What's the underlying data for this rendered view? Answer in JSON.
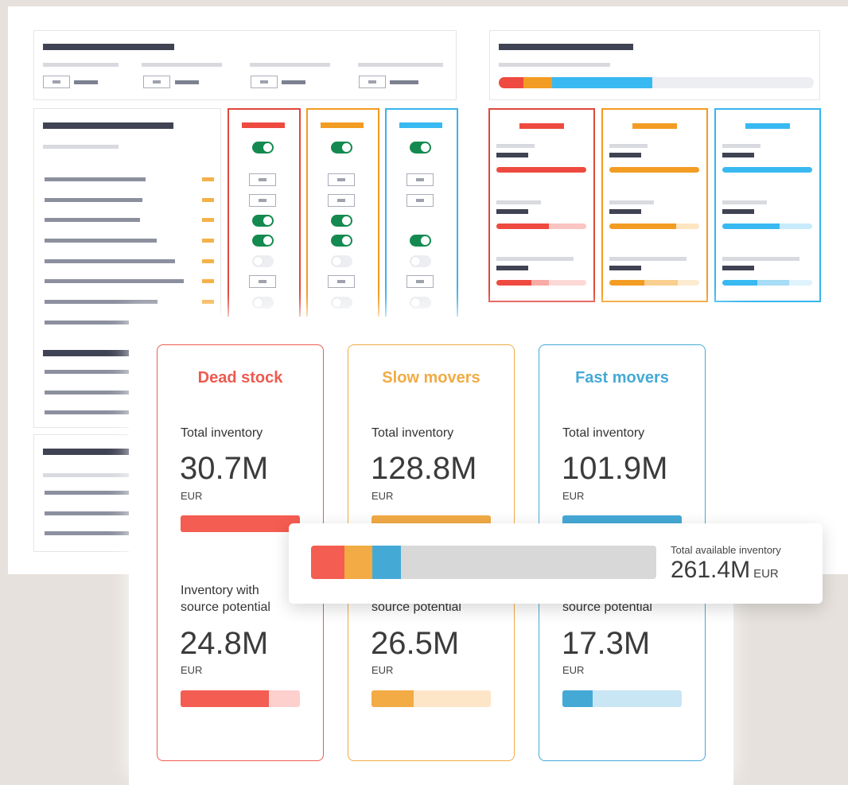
{
  "colors": {
    "dead": "#ee5a4f",
    "slow": "#f1ab45",
    "fast": "#45a9d6",
    "dead_bar": "#f45d51",
    "slow_bar": "#f2ab45",
    "fast_bar": "#45a9d6",
    "dead_light": "#fdd0cd",
    "slow_light": "#fde6c8",
    "fast_light": "#c9e6f4",
    "total_rest": "#d8d8d8"
  },
  "cards": [
    {
      "key": "dead",
      "title": "Dead stock",
      "total_label": "Total inventory",
      "total_value": "30.7M",
      "total_unit": "EUR",
      "total_fill_pct": 100,
      "source_label": "Inventory with\nsource potential",
      "source_value": "24.8M",
      "source_unit": "EUR",
      "source_fill_pct": 74
    },
    {
      "key": "slow",
      "title": "Slow movers",
      "total_label": "Total inventory",
      "total_value": "128.8M",
      "total_unit": "EUR",
      "total_fill_pct": 100,
      "source_label": "source potential",
      "source_value": "26.5M",
      "source_unit": "EUR",
      "source_fill_pct": 35
    },
    {
      "key": "fast",
      "title": "Fast movers",
      "total_label": "Total inventory",
      "total_value": "101.9M",
      "total_unit": "EUR",
      "total_fill_pct": 100,
      "source_label": "source potential",
      "source_value": "17.3M",
      "source_unit": "EUR",
      "source_fill_pct": 25
    }
  ],
  "total": {
    "label": "Total available inventory",
    "value": "261.4M",
    "unit": "EUR",
    "segments_pct": [
      9.7,
      8.1,
      8.3
    ]
  }
}
